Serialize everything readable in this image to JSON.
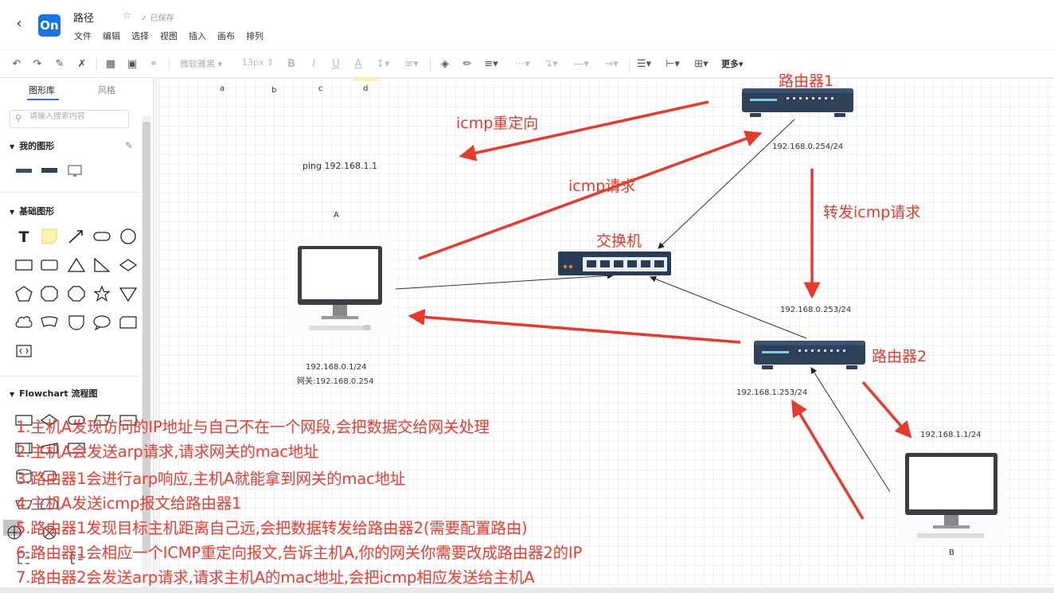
{
  "header": {
    "back_icon": "chevron-left-icon",
    "logo": "On",
    "title": "路径",
    "saved": "已保存",
    "menu": [
      "文件",
      "编辑",
      "选择",
      "视图",
      "插入",
      "画布",
      "排列"
    ]
  },
  "toolbar": {
    "font_name": "微软雅黑",
    "font_size": "13px",
    "more_label": "更多"
  },
  "sidebar": {
    "tab_library": "图形库",
    "tab_style": "风格",
    "search_placeholder": "请输入搜索内容",
    "section_my_shapes": "我的图形",
    "section_basic": "基础图形",
    "section_flowchart": "Flowchart 流程图"
  },
  "canvas": {
    "col_labels": [
      "a",
      "b",
      "c",
      "d"
    ],
    "ping_label": "ping 192.168.1.1",
    "host_a_label": "A",
    "host_a_ip": "192.168.0.1/24",
    "host_a_gateway": "网关:192.168.0.254",
    "router1_label": "路由器1",
    "router1_ip": "192.168.0.254/24",
    "router2_label": "路由器2",
    "router2_ip_up": "192.168.0.253/24",
    "router2_ip_down": "192.168.1.253/24",
    "switch_label": "交换机",
    "icmp_redirect": "icmp重定向",
    "icmp_request": "icmp请求",
    "forward_request": "转发icmp请求",
    "host_b_ip": "192.168.1.1/24",
    "host_b_label": "B",
    "steps": [
      "1.主机A发现访问的IP地址与自己不在一个网段,会把数据交给网关处理",
      "2.主机A会发送arp请求,请求网关的mac地址",
      "3.路由器1会进行arp响应,主机A就能拿到网关的mac地址",
      "4.主机A发送icmp报文给路由器1",
      "5.路由器1发现目标主机距离自己远,会把数据转发给路由器2(需要配置路由)",
      "6.路由器1会相应一个ICMP重定向报文,告诉主机A,你的网关你需要改成路由器2的IP",
      "7.路由器2会发送arp请求,请求主机A的mac地址,会把icmp相应发送给主机A"
    ]
  },
  "colors": {
    "accent": "#1673e6",
    "annotation_red": "#e8392b",
    "device_navy": "#2f4059"
  }
}
